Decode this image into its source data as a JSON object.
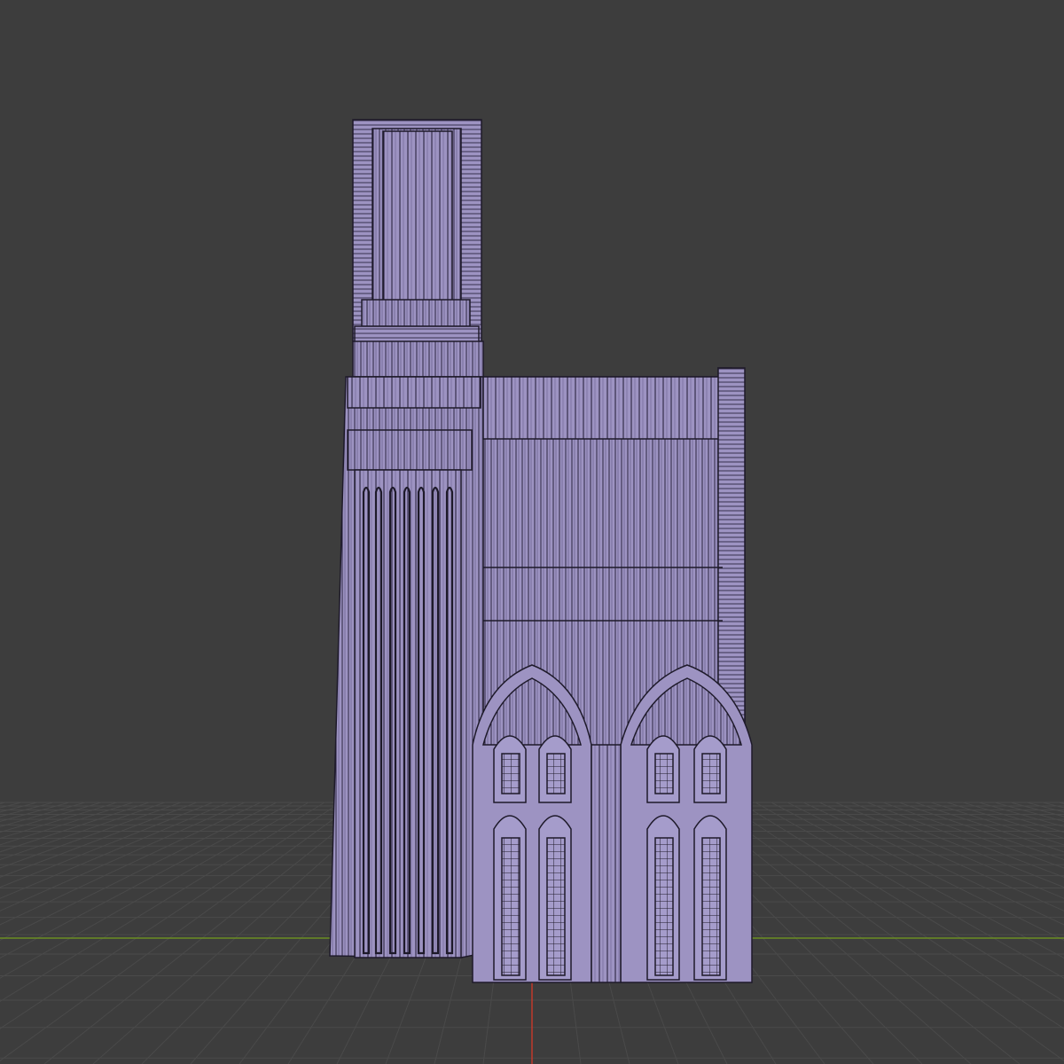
{
  "viewport": {
    "background": "#3d3d3d",
    "grid_color": "#4a4a4a",
    "x_axis_color": "#6b8e23",
    "y_axis_color": "#c0392b"
  },
  "model": {
    "fill": "#9d93c2",
    "edge": "#1e1a2a",
    "window_fill": "#a59ccb"
  }
}
